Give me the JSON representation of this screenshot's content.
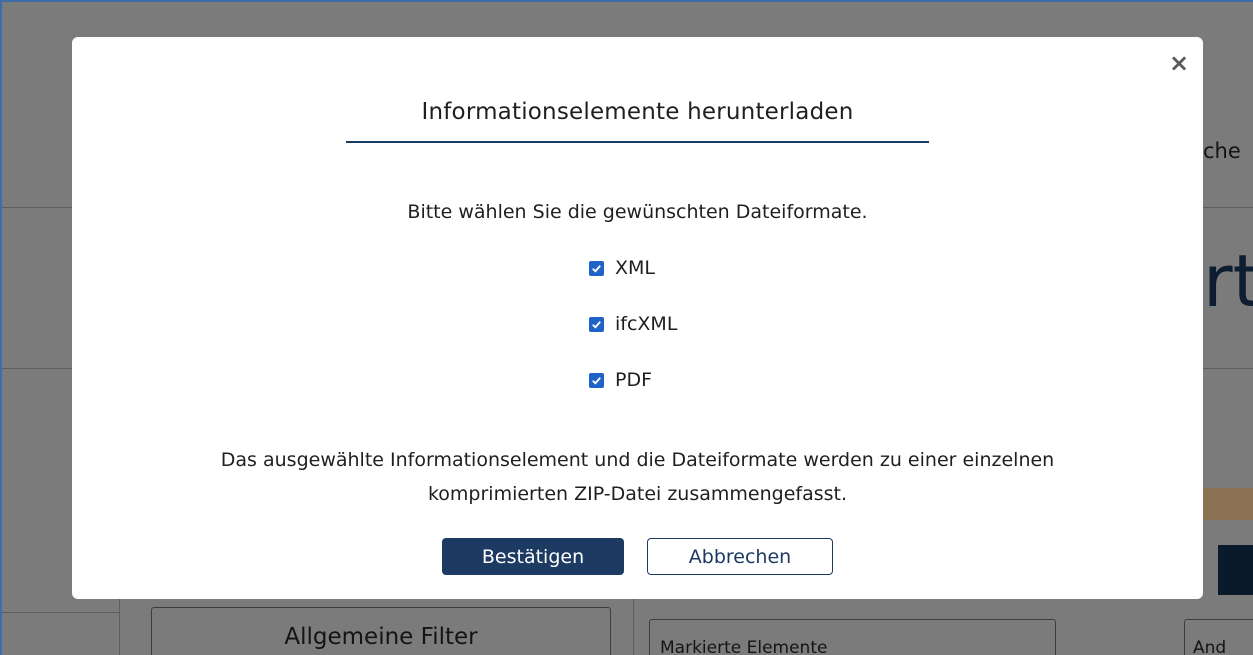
{
  "background": {
    "search_fragment": "che",
    "big_letter": "rt",
    "general_filter_label": "Allgemeine Filter",
    "marked_elements_label": "Markierte Elemente",
    "other_label": "And"
  },
  "modal": {
    "close_symbol": "×",
    "title": "Informationselemente herunterladen",
    "prompt": "Bitte wählen Sie die gewünschten Dateiformate.",
    "options": [
      {
        "label": "XML",
        "checked": true
      },
      {
        "label": "ifcXML",
        "checked": true
      },
      {
        "label": "PDF",
        "checked": true
      }
    ],
    "info_line1": "Das ausgewählte Informationselement und die Dateiformate werden zu einer einzelnen",
    "info_line2": "komprimierten ZIP-Datei zusammengefasst.",
    "confirm_label": "Bestätigen",
    "cancel_label": "Abbrechen"
  },
  "colors": {
    "accent": "#1c3a62",
    "checkbox": "#1f63c9",
    "overlay": "#7b7b7b"
  },
  "icons": {
    "close": "close-icon",
    "checkmark": "checkmark-icon"
  }
}
